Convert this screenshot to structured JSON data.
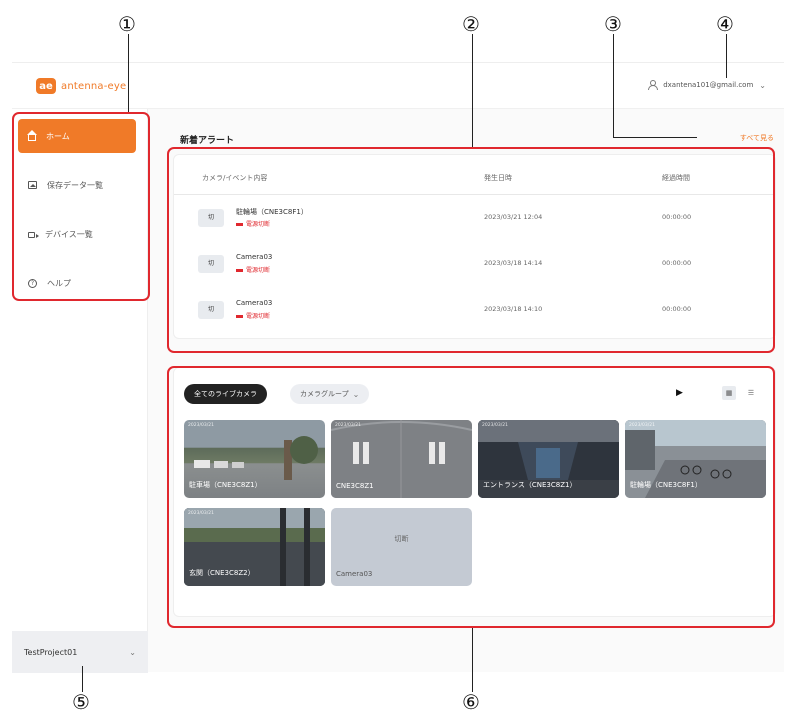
{
  "callouts": [
    "①",
    "②",
    "③",
    "④",
    "⑤",
    "⑥"
  ],
  "app": {
    "logo_mark": "ae",
    "logo_text": "antenna-eye",
    "user_email": "dxantena101@gmail.com",
    "accent_color": "#f07a28",
    "highlight_color": "#e0282e"
  },
  "sidebar": {
    "items": [
      {
        "label": "ホーム",
        "icon": "home-icon",
        "active": true
      },
      {
        "label": "保存データ一覧",
        "icon": "image-icon",
        "active": false
      },
      {
        "label": "デバイス一覧",
        "icon": "video-camera-icon",
        "active": false
      },
      {
        "label": "ヘルプ",
        "icon": "help-icon",
        "active": false
      }
    ],
    "project": "TestProject01"
  },
  "alerts": {
    "title": "新着アラート",
    "see_all": "すべて見る",
    "columns": [
      "カメラ/イベント内容",
      "発生日時",
      "経過時間"
    ],
    "rows": [
      {
        "thumb": "切",
        "name": "駐輪場（CNE3C8F1）",
        "tag": "電源切断",
        "date": "2023/03/21 12:04",
        "elapsed": "00:00:00"
      },
      {
        "thumb": "切",
        "name": "Camera03",
        "tag": "電源切断",
        "date": "2023/03/18 14:14",
        "elapsed": "00:00:00"
      },
      {
        "thumb": "切",
        "name": "Camera03",
        "tag": "電源切断",
        "date": "2023/03/18 14:10",
        "elapsed": "00:00:00"
      }
    ]
  },
  "live": {
    "all_cameras": "全てのライブカメラ",
    "camera_group": "カメラグループ",
    "play": "▶",
    "grid_view": "▦",
    "list_view": "☰",
    "tiles": [
      {
        "label": "駐車場（CNE3C8Z1）",
        "stamp": "2023/03/21",
        "kind": "parking"
      },
      {
        "label": "CNE3C8Z1",
        "stamp": "2023/03/21",
        "kind": "wall"
      },
      {
        "label": "エントランス（CNE3C8Z1）",
        "stamp": "2023/03/21",
        "kind": "entrance"
      },
      {
        "label": "駐輪場（CNE3C8F1）",
        "stamp": "2023/03/21",
        "kind": "bikes"
      },
      {
        "label": "玄関（CNE3C8Z2）",
        "stamp": "2023/03/21",
        "kind": "porch"
      },
      {
        "label": "Camera03",
        "center_text": "切断",
        "kind": "offline"
      }
    ]
  }
}
